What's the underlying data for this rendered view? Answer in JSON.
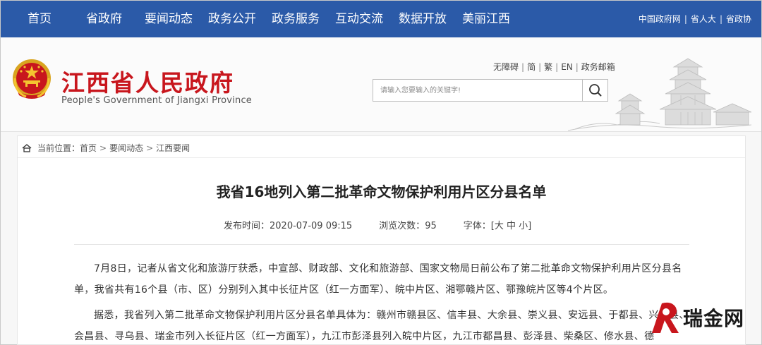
{
  "nav": {
    "items": [
      "首页",
      "省政府",
      "要闻动态",
      "政务公开",
      "政务服务",
      "互动交流",
      "数据开放",
      "美丽江西"
    ],
    "right_links": [
      "中国政府网",
      "省人大",
      "省政协"
    ]
  },
  "header": {
    "title": "江西省人民政府",
    "subtitle": "People's Government of Jiangxi Province",
    "util_links": [
      "无障碍",
      "简",
      "繁",
      "EN",
      "政务邮箱"
    ],
    "search_placeholder": "请输入您要输入的关键字!"
  },
  "breadcrumb": {
    "label": "当前位置：",
    "items": [
      "首页",
      "要闻动态",
      "江西要闻"
    ]
  },
  "article": {
    "title": "我省16地列入第二批革命文物保护利用片区分县名单",
    "publish_label": "发布时间：",
    "publish_time": "2020-07-09 09:15",
    "views_label": "浏览次数：",
    "views": "95",
    "font_label": "字体：",
    "font_sizes": [
      "[大",
      "中",
      "小]"
    ],
    "paragraph1": "7月8日，记者从省文化和旅游厅获悉，中宣部、财政部、文化和旅游部、国家文物局日前公布了第二批革命文物保护利用片区分县名单，我省共有16个县（市、区）分别列入其中长征片区（红一方面军）、皖中片区、湘鄂赣片区、鄂豫皖片区等4个片区。",
    "paragraph2": "据悉，我省列入第二批革命文物保护利用片区分县名单具体为：赣州市赣县区、信丰县、大余县、崇义县、安远县、于都县、兴国县、会昌县、寻乌县、瑞金市列入长征片区（红一方面军），九江市彭泽县列入皖中片区，九江市都昌县、彭泽县、柴桑区、修水县、德"
  },
  "watermark": {
    "text": "瑞金网"
  },
  "colors": {
    "nav_bg": "#2b5aa8",
    "title_red": "#c8161d"
  }
}
